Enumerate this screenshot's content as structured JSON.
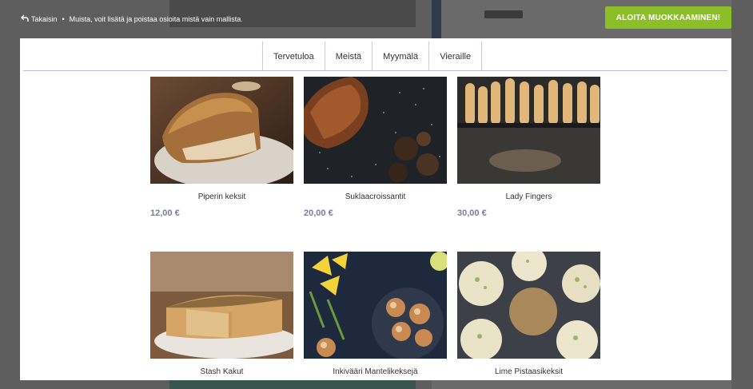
{
  "topbar": {
    "back_label": "Takaisin",
    "separator": "•",
    "notice": "Muista, voit lisätä ja poistaa osioita mistä vain mallista."
  },
  "start_button": {
    "label": "ALOITA MUOKKAAMINEN!"
  },
  "nav": {
    "items": [
      {
        "label": "Tervetuloa"
      },
      {
        "label": "Meistä"
      },
      {
        "label": "Myymälä"
      },
      {
        "label": "Vieraille"
      }
    ]
  },
  "products": [
    {
      "name": "Piperin keksit",
      "price": "12,00 €"
    },
    {
      "name": "Suklaacroissantit",
      "price": "20,00 €"
    },
    {
      "name": "Lady Fingers",
      "price": "30,00 €"
    },
    {
      "name": "Stash Kakut",
      "price": ""
    },
    {
      "name": "Inkivääri Mantelikeksejä",
      "price": ""
    },
    {
      "name": "Lime Pistaasikeksit",
      "price": ""
    }
  ],
  "colors": {
    "accent_button": "#8cbf26",
    "price_text": "#7a7ca6",
    "nav_border": "#b9bdd8"
  },
  "icons": {
    "back": "back-arrow-icon"
  }
}
